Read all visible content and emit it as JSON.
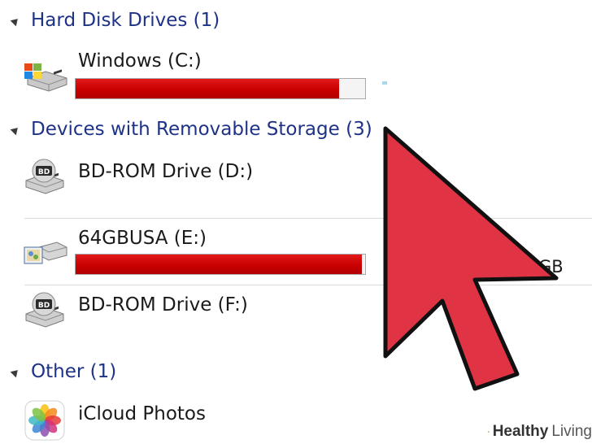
{
  "groups": [
    {
      "title": "Hard Disk Drives (1)"
    },
    {
      "title": "Devices with Removable Storage (3)"
    },
    {
      "title": "Other (1)"
    }
  ],
  "drives": [
    {
      "label": "Windows (C:)",
      "icon": "windows-hard-drive-icon",
      "usage_fraction": 0.91
    },
    {
      "label": "BD-ROM Drive (D:)",
      "icon": "bd-rom-drive-icon"
    },
    {
      "label": "64GBUSA (E:)",
      "icon": "usb-drive-icon",
      "usage_fraction": 0.99
    },
    {
      "label": "BD-ROM Drive (F:)",
      "icon": "bd-rom-drive-icon"
    },
    {
      "label": "iCloud Photos",
      "icon": "icloud-photos-icon"
    }
  ],
  "overlay": {
    "partial_text": "GB",
    "pointer": "red-arrow-pointer-icon"
  },
  "watermark": {
    "brand": "Healthy",
    "brand2": "Living"
  },
  "colors": {
    "group_title": "#1e3287",
    "usage_bar": "#cc0000",
    "pointer_fill": "#e03444"
  }
}
